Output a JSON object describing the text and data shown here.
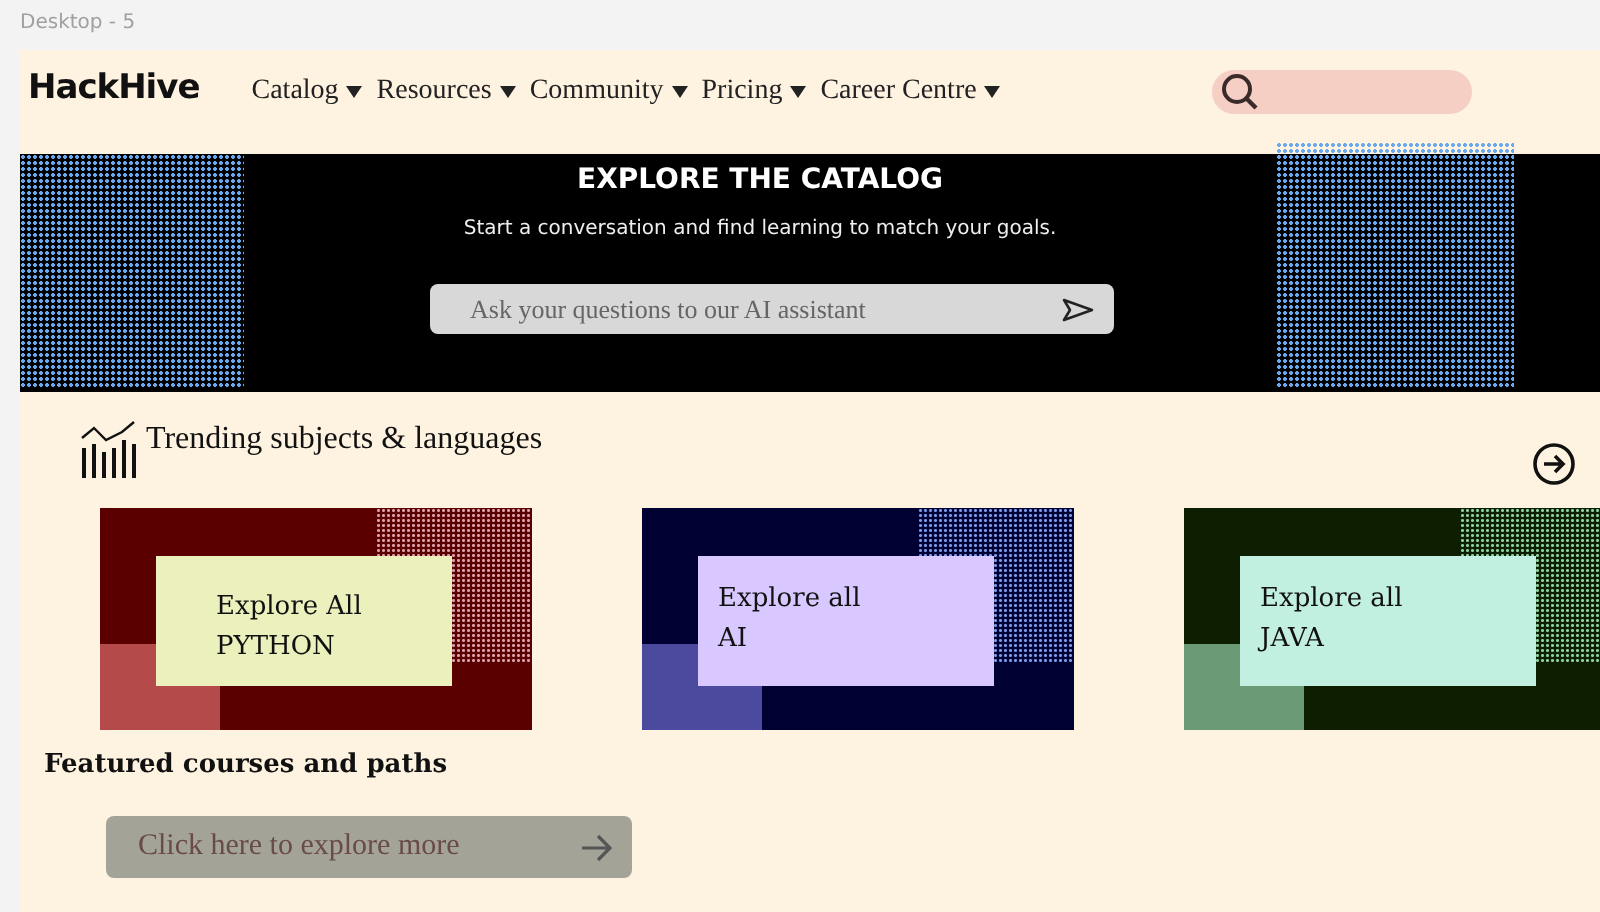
{
  "canvas_label": "Desktop - 5",
  "logo": "HackHive",
  "nav": [
    {
      "label": "Catalog"
    },
    {
      "label": "Resources"
    },
    {
      "label": "Community"
    },
    {
      "label": "Pricing"
    },
    {
      "label": "Career Centre"
    }
  ],
  "hero": {
    "title": "EXPLORE THE CATALOG",
    "subtitle": "Start a conversation and find learning to match your goals.",
    "ask_field": {
      "placeholder": "Ask your questions to our AI assistant"
    }
  },
  "trending": {
    "title": "Trending subjects & languages"
  },
  "cards": [
    {
      "line_1": "Explore All",
      "line_2": "PYTHON",
      "color": "#5a0000",
      "kind": "red"
    },
    {
      "line_1": "Explore all",
      "line_2": "AI",
      "color": "#000033",
      "kind": "blue"
    },
    {
      "line_1": "Explore all",
      "line_2": "JAVA",
      "color": "#0e1e00",
      "kind": "green"
    }
  ],
  "featured": {
    "title": "Featured courses and paths",
    "button": "Click here to explore more"
  }
}
